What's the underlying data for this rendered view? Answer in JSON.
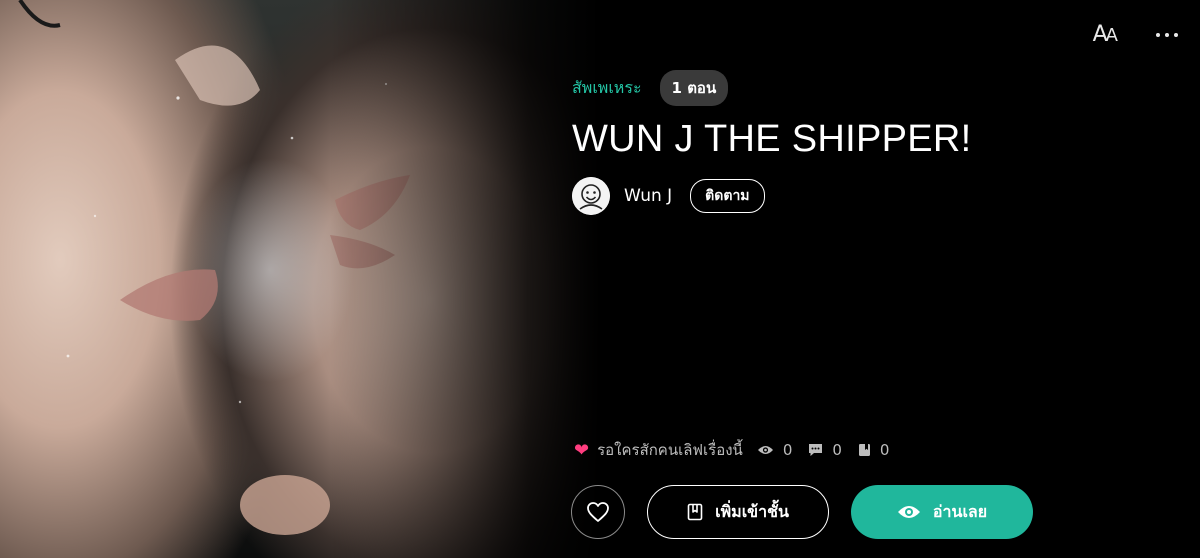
{
  "header": {
    "font_size_label_big": "A",
    "font_size_label_small": "A"
  },
  "story": {
    "category": "สัพเพเหระ",
    "episodes": "1 ตอน",
    "title": "WUN J THE SHIPPER!",
    "author": "Wun J",
    "follow_label": "ติดตาม"
  },
  "stats": {
    "love_text": "รอใครสักคนเลิฟเรื่องนี้",
    "views": "0",
    "comments": "0",
    "library_adds": "0"
  },
  "actions": {
    "add_library_label": "เพิ่มเข้าชั้น",
    "read_label": "อ่านเลย"
  },
  "colors": {
    "accent": "#20b79c",
    "category": "#24c6a6",
    "heart": "#ff3d7f",
    "background": "#000000"
  },
  "icons": [
    "aa-font-size-icon",
    "more-dots-icon",
    "heart-icon",
    "eye-icon",
    "comment-icon",
    "bookmark-icon",
    "book-icon"
  ]
}
